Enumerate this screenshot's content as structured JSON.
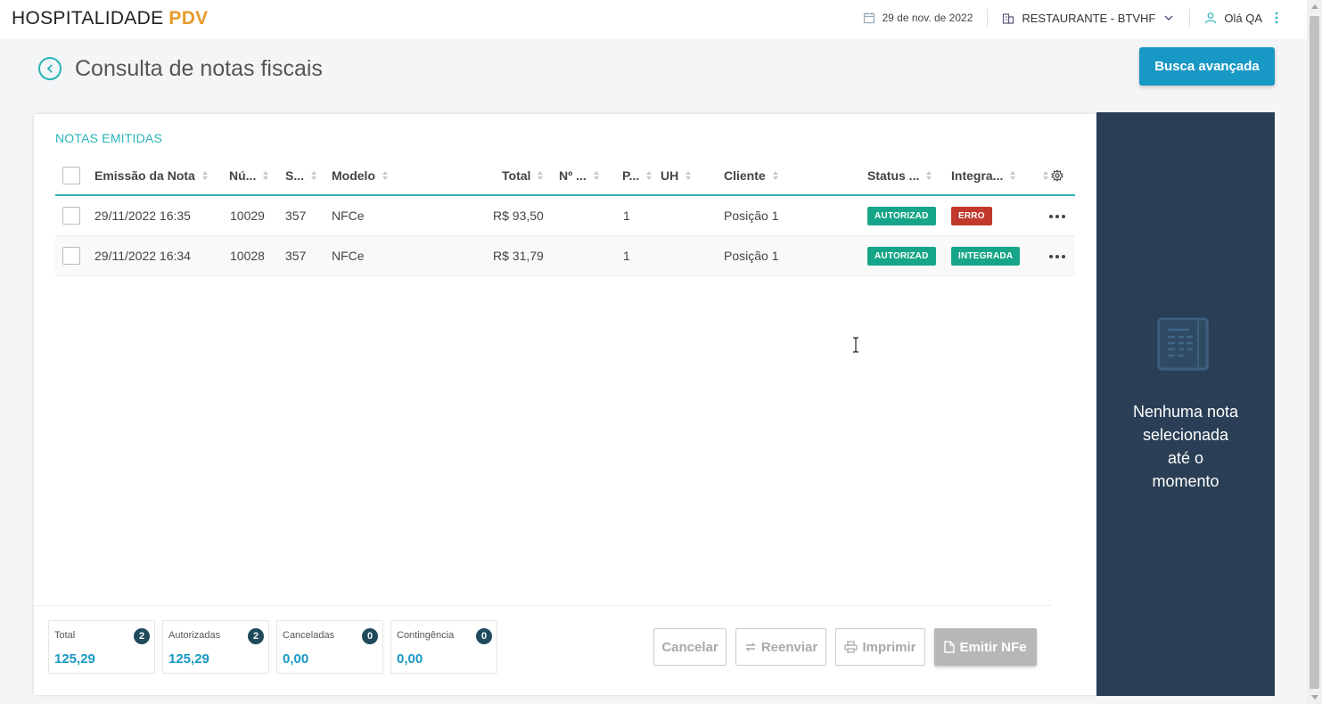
{
  "header": {
    "logo_main": "HOSPITALIDADE",
    "logo_accent": "PDV",
    "date": "29 de nov. de 2022",
    "establishment": "RESTAURANTE - BTVHF",
    "user_greeting": "Olá QA"
  },
  "page": {
    "title": "Consulta de notas fiscais",
    "advanced_search_label": "Busca avançada"
  },
  "table": {
    "section_title": "NOTAS EMITIDAS",
    "columns": {
      "emissao": "Emissão da Nota",
      "numero": "Nú...",
      "serie": "S...",
      "modelo": "Modelo",
      "total": "Total",
      "n": "Nº ...",
      "p": "P...",
      "uh": "UH",
      "cliente": "Cliente",
      "status": "Status ...",
      "integra": "Integra..."
    },
    "rows": [
      {
        "emissao": "29/11/2022 16:35",
        "numero": "10029",
        "serie": "357",
        "modelo": "NFCe",
        "total": "R$ 93,50",
        "n": "",
        "p": "1",
        "uh": "",
        "cliente": "Posição 1",
        "status": "AUTORIZAD",
        "integra": "ERRO"
      },
      {
        "emissao": "29/11/2022 16:34",
        "numero": "10028",
        "serie": "357",
        "modelo": "NFCe",
        "total": "R$ 31,79",
        "n": "",
        "p": "1",
        "uh": "",
        "cliente": "Posição 1",
        "status": "AUTORIZAD",
        "integra": "INTEGRADA"
      }
    ]
  },
  "summary": [
    {
      "label": "Total",
      "count": "2",
      "value": "125,29"
    },
    {
      "label": "Autorizadas",
      "count": "2",
      "value": "125,29"
    },
    {
      "label": "Canceladas",
      "count": "0",
      "value": "0,00"
    },
    {
      "label": "Contingência",
      "count": "0",
      "value": "0,00"
    }
  ],
  "actions": {
    "cancel": "Cancelar",
    "resend": "Reenviar",
    "print": "Imprimir",
    "emit": "Emitir NFe"
  },
  "side_panel": {
    "empty_message": "Nenhuma nota selecionada até o momento"
  },
  "colors": {
    "accent": "#2ab3b8",
    "primary_button": "#1898c4",
    "side_panel": "#2a3f55",
    "status_ok": "#17a589",
    "status_error": "#c0392b"
  },
  "icons": [
    "calendar-icon",
    "building-icon",
    "chevron-down-icon",
    "user-icon",
    "kebab-icon",
    "back-arrow-icon",
    "settings-icon",
    "refresh-icon",
    "print-icon",
    "document-icon",
    "invoice-illustration-icon",
    "text-cursor-icon"
  ]
}
